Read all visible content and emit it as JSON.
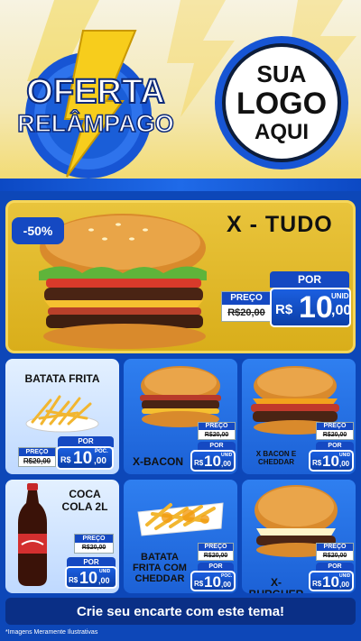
{
  "header": {
    "badge_line1": "OFERTA",
    "badge_line2": "RELÂMPAGO",
    "logo_line1": "SUA",
    "logo_line2": "LOGO",
    "logo_line3": "AQUI"
  },
  "featured": {
    "discount": "-50%",
    "name": "X - TUDO",
    "por_label": "POR",
    "preco_label": "PREÇO",
    "old_price": "R$20,00",
    "currency": "R$",
    "price_int": "10",
    "price_cents": ",00",
    "unit": "UNID"
  },
  "products": [
    {
      "name": "BATATA FRITA",
      "por_label": "POR",
      "preco_label": "PREÇO",
      "old_price": "R$20,00",
      "currency": "R$",
      "price_int": "10",
      "price_cents": ",00",
      "unit": "POC."
    },
    {
      "name": "X-BACON",
      "por_label": "POR",
      "preco_label": "PREÇO",
      "old_price": "R$20,00",
      "currency": "R$",
      "price_int": "10",
      "price_cents": ",00",
      "unit": "UNID"
    },
    {
      "name": "X BACON E CHEDDAR",
      "por_label": "POR",
      "preco_label": "PREÇO",
      "old_price": "R$20,00",
      "currency": "R$",
      "price_int": "10",
      "price_cents": ",00",
      "unit": "UNID"
    },
    {
      "name": "COCA COLA 2L",
      "por_label": "POR",
      "preco_label": "PREÇO",
      "old_price": "R$20,00",
      "currency": "R$",
      "price_int": "10",
      "price_cents": ",00",
      "unit": "UNID"
    },
    {
      "name": "BATATA FRITA COM CHEDDAR",
      "por_label": "POR",
      "preco_label": "PREÇO",
      "old_price": "R$20,00",
      "currency": "R$",
      "price_int": "10",
      "price_cents": ",00",
      "unit": "POC."
    },
    {
      "name": "X-BURGUER",
      "por_label": "POR",
      "preco_label": "PREÇO",
      "old_price": "R$20,00",
      "currency": "R$",
      "price_int": "10",
      "price_cents": ",00",
      "unit": "UNID"
    }
  ],
  "footer": {
    "cta": "Crie seu encarte com este tema!",
    "disclaimer": "*Imagens Meramente Ilustrativas"
  },
  "colors": {
    "brand_blue": "#1549c2",
    "gold": "#e0b62a",
    "bg_blue": "#0d47b8"
  }
}
